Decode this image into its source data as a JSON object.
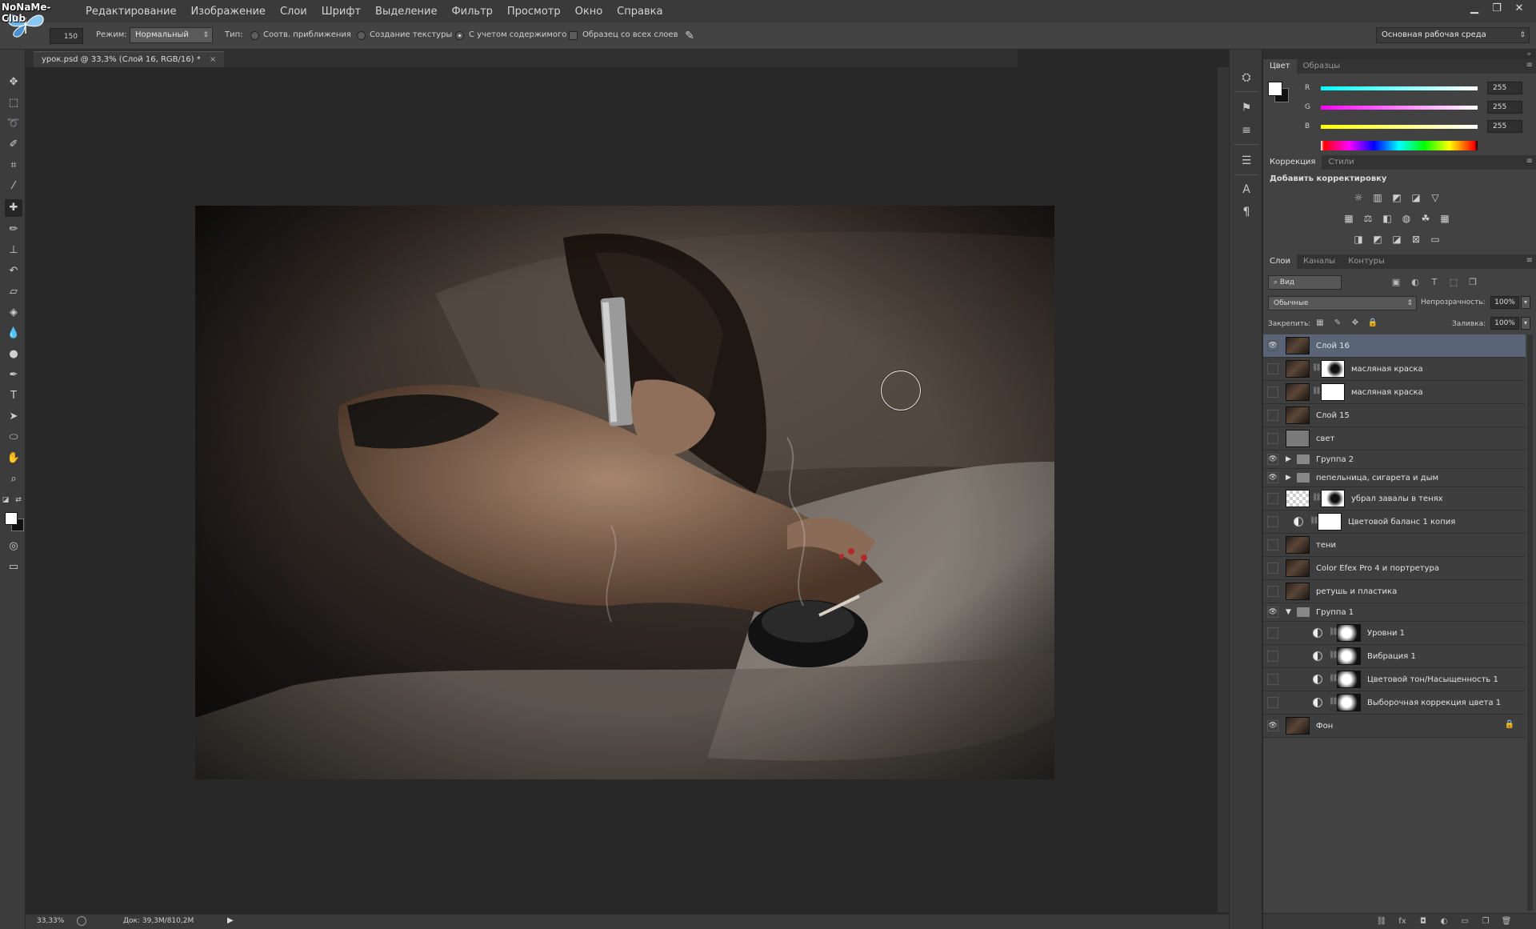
{
  "menubar": {
    "logo_text": "NoNaMe-Club",
    "items": [
      "Редактирование",
      "Изображение",
      "Слои",
      "Шрифт",
      "Выделение",
      "Фильтр",
      "Просмотр",
      "Окно",
      "Справка"
    ]
  },
  "window_controls": [
    "minimize",
    "restore",
    "close"
  ],
  "options": {
    "brush_size": "150",
    "mode_label": "Режим:",
    "mode_value": "Нормальный",
    "type_label": "Тип:",
    "type_options": [
      "Соотв. приближения",
      "Создание текстуры",
      "С учетом содержимого"
    ],
    "type_selected": "С учетом содержимого",
    "sample_all_layers": "Образец со всех слоев",
    "workspace": "Основная рабочая среда"
  },
  "document": {
    "tab_title": "урок.psd @ 33,3% (Слой 16, RGB/16) *"
  },
  "status": {
    "zoom": "33,33%",
    "doc_size": "Док: 39,3M/810,2M"
  },
  "color_panel": {
    "tabs": [
      "Цвет",
      "Образцы"
    ],
    "r_label": "R",
    "g_label": "G",
    "b_label": "B",
    "r": "255",
    "g": "255",
    "b": "255"
  },
  "adjustments_panel": {
    "tabs": [
      "Коррекция",
      "Стили"
    ],
    "title": "Добавить корректировку"
  },
  "layers_panel": {
    "tabs": [
      "Слои",
      "Каналы",
      "Контуры"
    ],
    "kind_filter": "Вид",
    "blend_mode": "Обычные",
    "opacity_label": "Непрозрачность:",
    "opacity": "100%",
    "lock_label": "Закрепить:",
    "fill_label": "Заливка:",
    "fill": "100%",
    "layers": [
      {
        "name": "Слой 16",
        "visible": true,
        "selected": true,
        "kind": "pixel"
      },
      {
        "name": "масляная краска",
        "visible": false,
        "kind": "masked"
      },
      {
        "name": "масляная краска",
        "visible": false,
        "kind": "masked"
      },
      {
        "name": "Слой 15",
        "visible": false,
        "kind": "pixel"
      },
      {
        "name": "свет",
        "visible": false,
        "kind": "pixel"
      },
      {
        "name": "Группа 2",
        "visible": true,
        "kind": "group",
        "expanded": false
      },
      {
        "name": "пепельница, сигарета и дым",
        "visible": true,
        "kind": "group",
        "expanded": false
      },
      {
        "name": "убрал завалы в тенях",
        "visible": false,
        "kind": "masked"
      },
      {
        "name": "Цветовой баланс 1 копия",
        "visible": false,
        "kind": "adjustment"
      },
      {
        "name": "тени",
        "visible": false,
        "kind": "pixel"
      },
      {
        "name": "Color Efex Pro 4 и портретура",
        "visible": false,
        "kind": "pixel"
      },
      {
        "name": "ретушь и пластика",
        "visible": false,
        "kind": "pixel"
      },
      {
        "name": "Группа 1",
        "visible": true,
        "kind": "group",
        "expanded": true
      },
      {
        "name": "Уровни 1",
        "visible": false,
        "kind": "adjustment",
        "indent": true
      },
      {
        "name": "Вибрация 1",
        "visible": false,
        "kind": "adjustment",
        "indent": true
      },
      {
        "name": "Цветовой тон/Насыщенность 1",
        "visible": false,
        "kind": "adjustment",
        "indent": true
      },
      {
        "name": "Выборочная коррекция цвета 1",
        "visible": false,
        "kind": "adjustment",
        "indent": true
      },
      {
        "name": "Фон",
        "visible": true,
        "kind": "background",
        "locked": true
      }
    ]
  }
}
